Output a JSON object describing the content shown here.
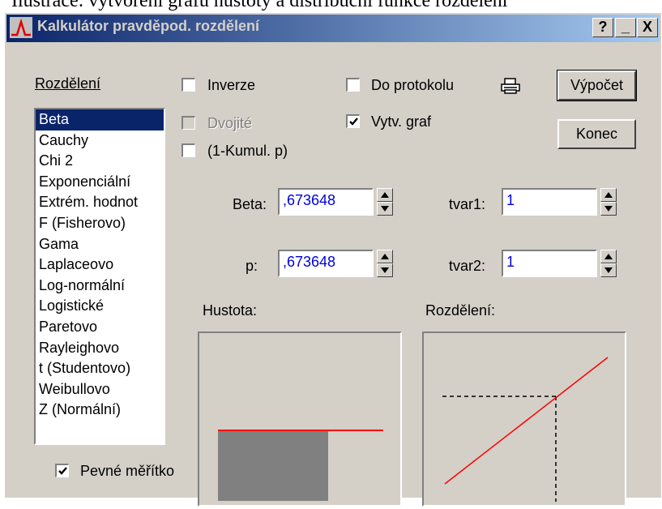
{
  "doc_heading": "Ilustrace: vytvoření grafu hustoty a distribuční funkce rozdělení",
  "window": {
    "title": "Kalkulátor pravděpod. rozdělení",
    "help_label": "?",
    "minimize_label": "_",
    "close_label": "X"
  },
  "distribution": {
    "label": "Rozdělení",
    "items": [
      "Beta",
      "Cauchy",
      "Chi 2",
      "Exponenciální",
      "Extrém. hodnot",
      "F (Fisherovo)",
      "Gama",
      "Laplaceovo",
      "Log-normální",
      "Logistické",
      "Paretovo",
      "Rayleighovo",
      "t (Studentovo)",
      "Weibullovo",
      "Z (Normální)"
    ],
    "selected_index": 0
  },
  "options": {
    "inverse": {
      "label": "Inverze",
      "checked": false
    },
    "double": {
      "label": "Dvojité",
      "checked": false,
      "enabled": false
    },
    "cumul": {
      "label": "(1-Kumul. p)",
      "checked": false
    },
    "to_log": {
      "label": "Do protokolu",
      "checked": false
    },
    "create_graph": {
      "label": "Vytv. graf",
      "checked": true
    },
    "fixed_scale": {
      "label": "Pevné měřítko",
      "checked": true
    }
  },
  "buttons": {
    "compute": "Výpočet",
    "close": "Konec"
  },
  "fields": {
    "beta": {
      "label": "Beta:",
      "value": ",673648"
    },
    "p": {
      "label": "p:",
      "value": ",673648"
    },
    "shape1": {
      "label": "tvar1:",
      "value": "1"
    },
    "shape2": {
      "label": "tvar2:",
      "value": "1"
    }
  },
  "graphs": {
    "density_label": "Hustota:",
    "distribution_label": "Rozdělení:"
  },
  "colors": {
    "title_start": "#0a246a",
    "title_end": "#a6caf0",
    "face": "#d4d0c8",
    "value_text": "#0000e0",
    "curve": "#ff0000",
    "area_fill": "#808080"
  },
  "icons": {
    "app": "distribution-curve-icon",
    "print": "printer-icon"
  }
}
